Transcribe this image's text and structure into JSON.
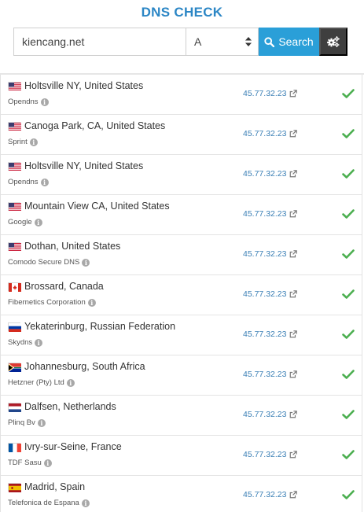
{
  "page": {
    "title": "DNS CHECK"
  },
  "search": {
    "domain": "kiencang.net",
    "record_type": "A",
    "search_label": "Search"
  },
  "colors": {
    "accent": "#2a9fd8",
    "title": "#2b86c5",
    "ok": "#4caf50",
    "link": "#3a7fb5"
  },
  "results": [
    {
      "location": "Holtsville NY, United States",
      "country": "us",
      "provider": "Opendns",
      "ip": "45.77.32.23",
      "status": "ok"
    },
    {
      "location": "Canoga Park, CA, United States",
      "country": "us",
      "provider": "Sprint",
      "ip": "45.77.32.23",
      "status": "ok"
    },
    {
      "location": "Holtsville NY, United States",
      "country": "us",
      "provider": "Opendns",
      "ip": "45.77.32.23",
      "status": "ok"
    },
    {
      "location": "Mountain View CA, United States",
      "country": "us",
      "provider": "Google",
      "ip": "45.77.32.23",
      "status": "ok"
    },
    {
      "location": "Dothan, United States",
      "country": "us",
      "provider": "Comodo Secure DNS",
      "ip": "45.77.32.23",
      "status": "ok"
    },
    {
      "location": "Brossard, Canada",
      "country": "ca",
      "provider": "Fibernetics Corporation",
      "ip": "45.77.32.23",
      "status": "ok"
    },
    {
      "location": "Yekaterinburg, Russian Federation",
      "country": "ru",
      "provider": "Skydns",
      "ip": "45.77.32.23",
      "status": "ok"
    },
    {
      "location": "Johannesburg, South Africa",
      "country": "za",
      "provider": "Hetzner (Pty) Ltd",
      "ip": "45.77.32.23",
      "status": "ok"
    },
    {
      "location": "Dalfsen, Netherlands",
      "country": "nl",
      "provider": "Plinq Bv",
      "ip": "45.77.32.23",
      "status": "ok"
    },
    {
      "location": "Ivry-sur-Seine, France",
      "country": "fr",
      "provider": "TDF Sasu",
      "ip": "45.77.32.23",
      "status": "ok"
    },
    {
      "location": "Madrid, Spain",
      "country": "es",
      "provider": "Telefonica de Espana",
      "ip": "45.77.32.23",
      "status": "ok"
    }
  ]
}
